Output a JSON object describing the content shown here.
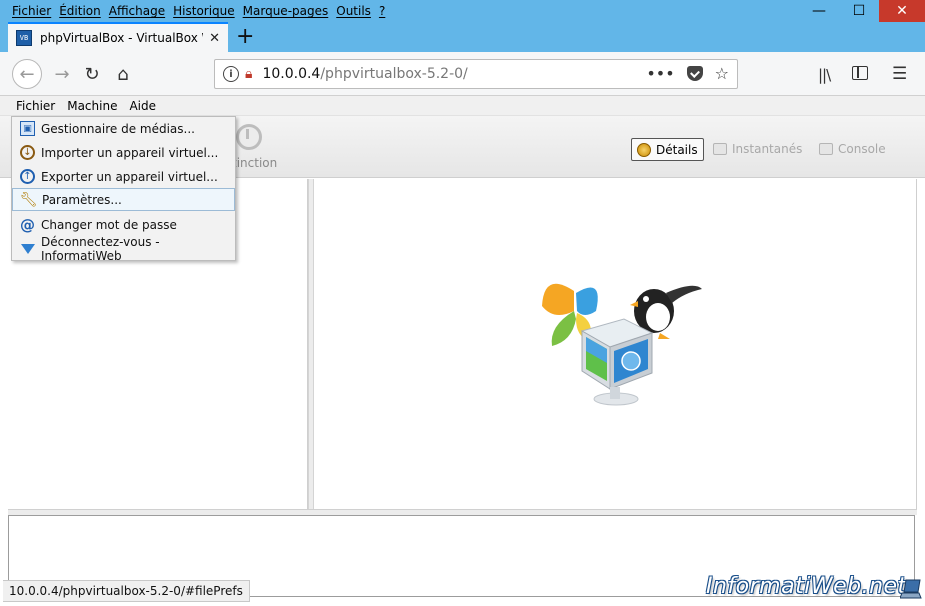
{
  "firefox": {
    "menus": [
      "Fichier",
      "Édition",
      "Affichage",
      "Historique",
      "Marque-pages",
      "Outils",
      "?"
    ],
    "tab": {
      "title": "phpVirtualBox - VirtualBox Web",
      "close": "✕"
    },
    "new_tab": "+",
    "url": {
      "host": "10.0.0.4",
      "path": "/phpvirtualbox-5.2-0/"
    },
    "url_actions": {
      "more": "•••",
      "star": "☆"
    },
    "nav": {
      "back": "←",
      "forward": "→",
      "reload": "↻",
      "home": "⌂",
      "menu": "☰",
      "library": "||\\"
    },
    "window": {
      "minimize": "—",
      "maximize": "☐",
      "close": "✕"
    }
  },
  "app": {
    "menus": [
      "Fichier",
      "Machine",
      "Aide"
    ],
    "toolbar": {
      "stop_label": "tinction"
    },
    "view_tabs": {
      "details": "Détails",
      "snapshots": "Instantanés",
      "console": "Console"
    }
  },
  "file_menu": {
    "items": [
      {
        "label": "Gestionnaire de médias...",
        "icon": "media-icon"
      },
      {
        "label": "Importer un appareil virtuel...",
        "icon": "import-icon"
      },
      {
        "label": "Exporter un appareil virtuel...",
        "icon": "export-icon"
      },
      {
        "label": "Paramètres...",
        "icon": "wrench-icon",
        "highlighted": true
      },
      {
        "label": "Changer mot de passe",
        "icon": "at-icon"
      },
      {
        "label": "Déconnectez-vous - InformatiWeb",
        "icon": "logout-icon"
      }
    ]
  },
  "status": {
    "url": "10.0.0.4/phpvirtualbox-5.2-0/#filePrefs"
  },
  "watermark": "InformatiWeb.net",
  "colors": {
    "titlebar": "#62b6e8",
    "close": "#c7392b",
    "accent": "#0a84ff"
  }
}
